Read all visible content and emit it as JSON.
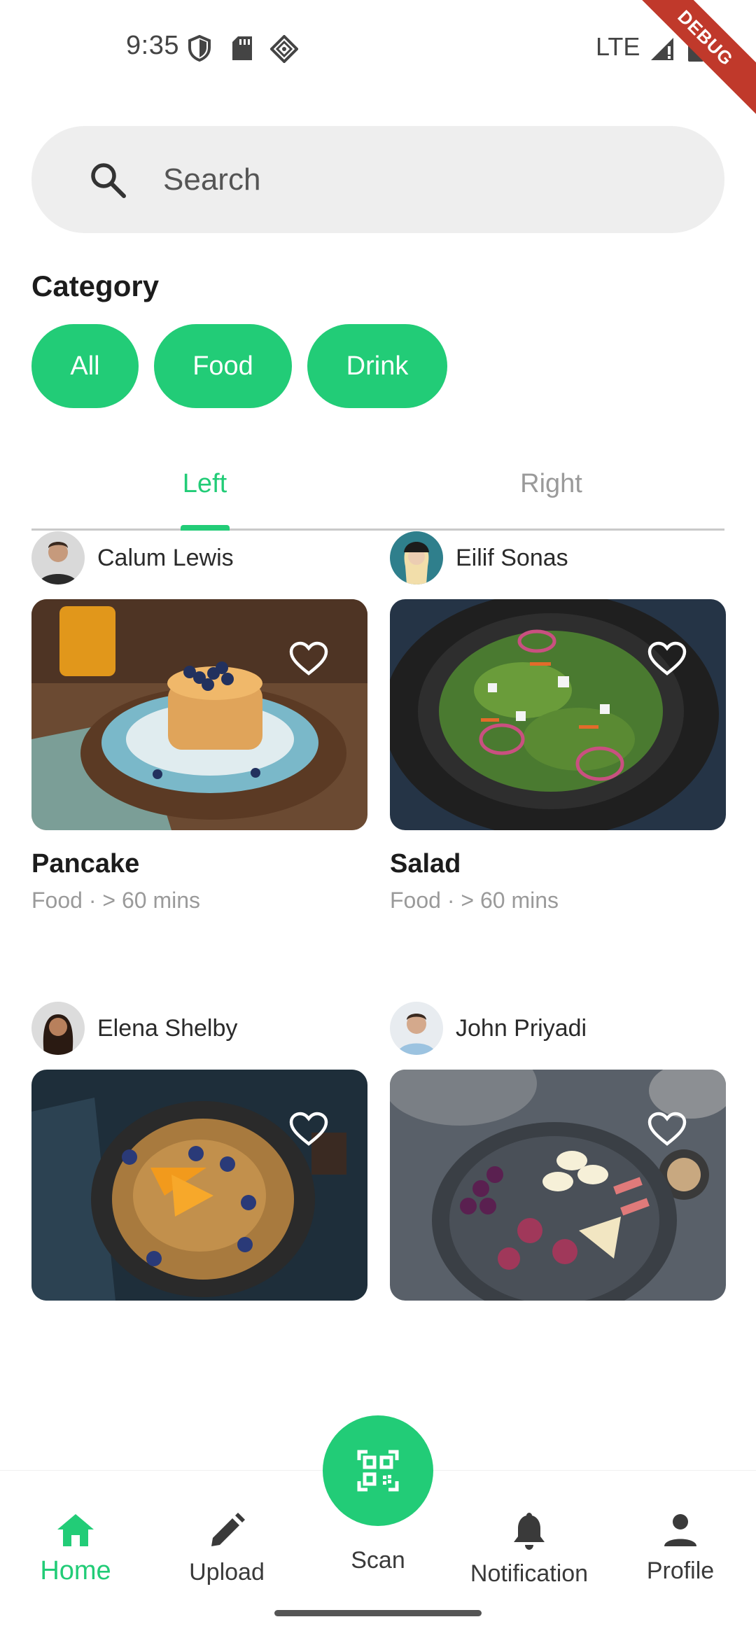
{
  "status_bar": {
    "time": "9:35",
    "network": "LTE",
    "debug_label": "DEBUG",
    "icons": [
      "shield-icon",
      "sd-card-icon",
      "location-diamond-icon",
      "signal-icon",
      "battery-icon"
    ]
  },
  "search": {
    "placeholder": "Search",
    "value": ""
  },
  "category": {
    "title": "Category",
    "chips": [
      "All",
      "Food",
      "Drink"
    ]
  },
  "tabs": {
    "items": [
      "Left",
      "Right"
    ],
    "selected": "Left"
  },
  "cards": [
    {
      "author": "Calum Lewis",
      "title": "Pancake",
      "meta": "Food · > 60 mins"
    },
    {
      "author": "Eilif Sonas",
      "title": "Salad",
      "meta": "Food · > 60 mins"
    },
    {
      "author": "Elena Shelby",
      "title": "",
      "meta": ""
    },
    {
      "author": "John Priyadi",
      "title": "",
      "meta": ""
    }
  ],
  "bottom_nav": {
    "items": [
      {
        "label": "Home",
        "icon": "home-icon"
      },
      {
        "label": "Upload",
        "icon": "pencil-icon"
      },
      {
        "label": "Scan",
        "icon": "qr-scan-icon"
      },
      {
        "label": "Notification",
        "icon": "bell-icon"
      },
      {
        "label": "Profile",
        "icon": "person-icon"
      }
    ],
    "selected": "Home"
  },
  "colors": {
    "accent": "#22cc77",
    "search_bg": "#eeeeee",
    "muted_text": "#9a9a9a",
    "debug_ribbon": "#c0392b"
  }
}
